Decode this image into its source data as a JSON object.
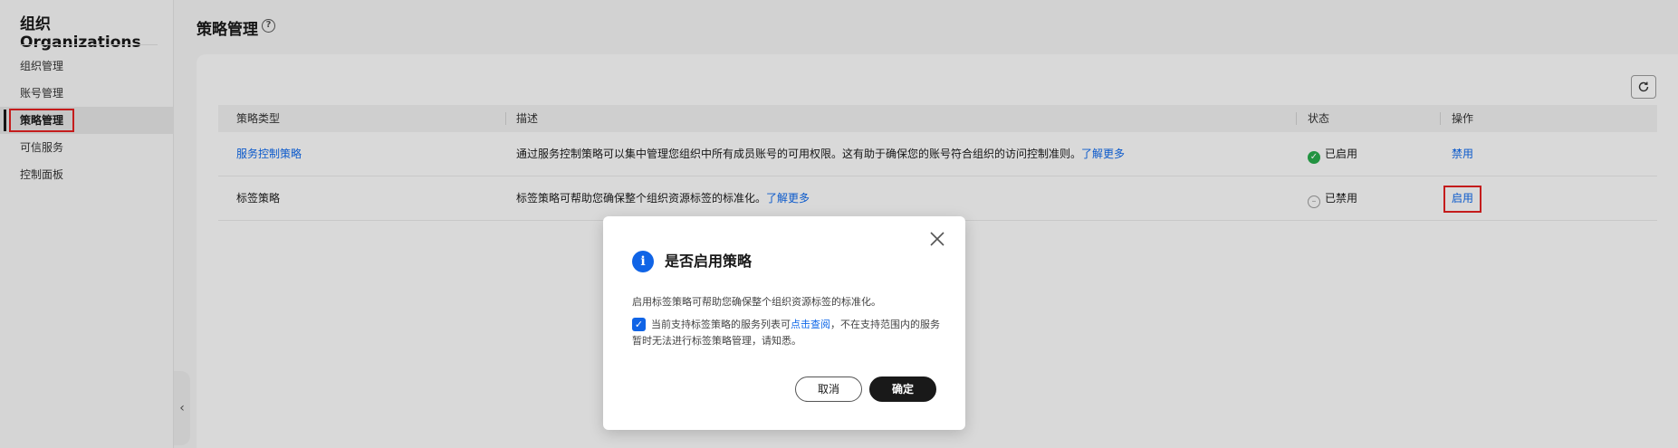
{
  "sidebar": {
    "title": "组织 Organizations",
    "items": [
      {
        "label": "组织管理"
      },
      {
        "label": "账号管理"
      },
      {
        "label": "策略管理"
      },
      {
        "label": "可信服务"
      },
      {
        "label": "控制面板"
      }
    ],
    "collapse_glyph": "‹"
  },
  "page": {
    "title": "策略管理",
    "help_glyph": "?"
  },
  "table": {
    "columns": [
      "策略类型",
      "描述",
      "状态",
      "操作"
    ],
    "rows": [
      {
        "type": "服务控制策略",
        "desc": "通过服务控制策略可以集中管理您组织中所有成员账号的可用权限。这有助于确保您的账号符合组织的访问控制准则。",
        "learn_more": "了解更多",
        "status": "已启用",
        "action": "禁用"
      },
      {
        "type": "标签策略",
        "desc": "标签策略可帮助您确保整个组织资源标签的标准化。",
        "learn_more": "了解更多",
        "status": "已禁用",
        "action": "启用"
      }
    ]
  },
  "dialog": {
    "title": "是否启用策略",
    "description": "启用标签策略可帮助您确保整个组织资源标签的标准化。",
    "note_prefix": "当前支持标签策略的服务列表可",
    "note_link": "点击查阅",
    "note_suffix": "，不在支持范围内的服务暂时无法进行标签策略管理，请知悉。",
    "checkbox_checked": true,
    "cancel_label": "取消",
    "confirm_label": "确定"
  },
  "colors": {
    "link": "#0e67e8",
    "primary_button": "#191919",
    "info": "#1064e6",
    "success": "#27a84b",
    "highlight": "#e02020"
  }
}
